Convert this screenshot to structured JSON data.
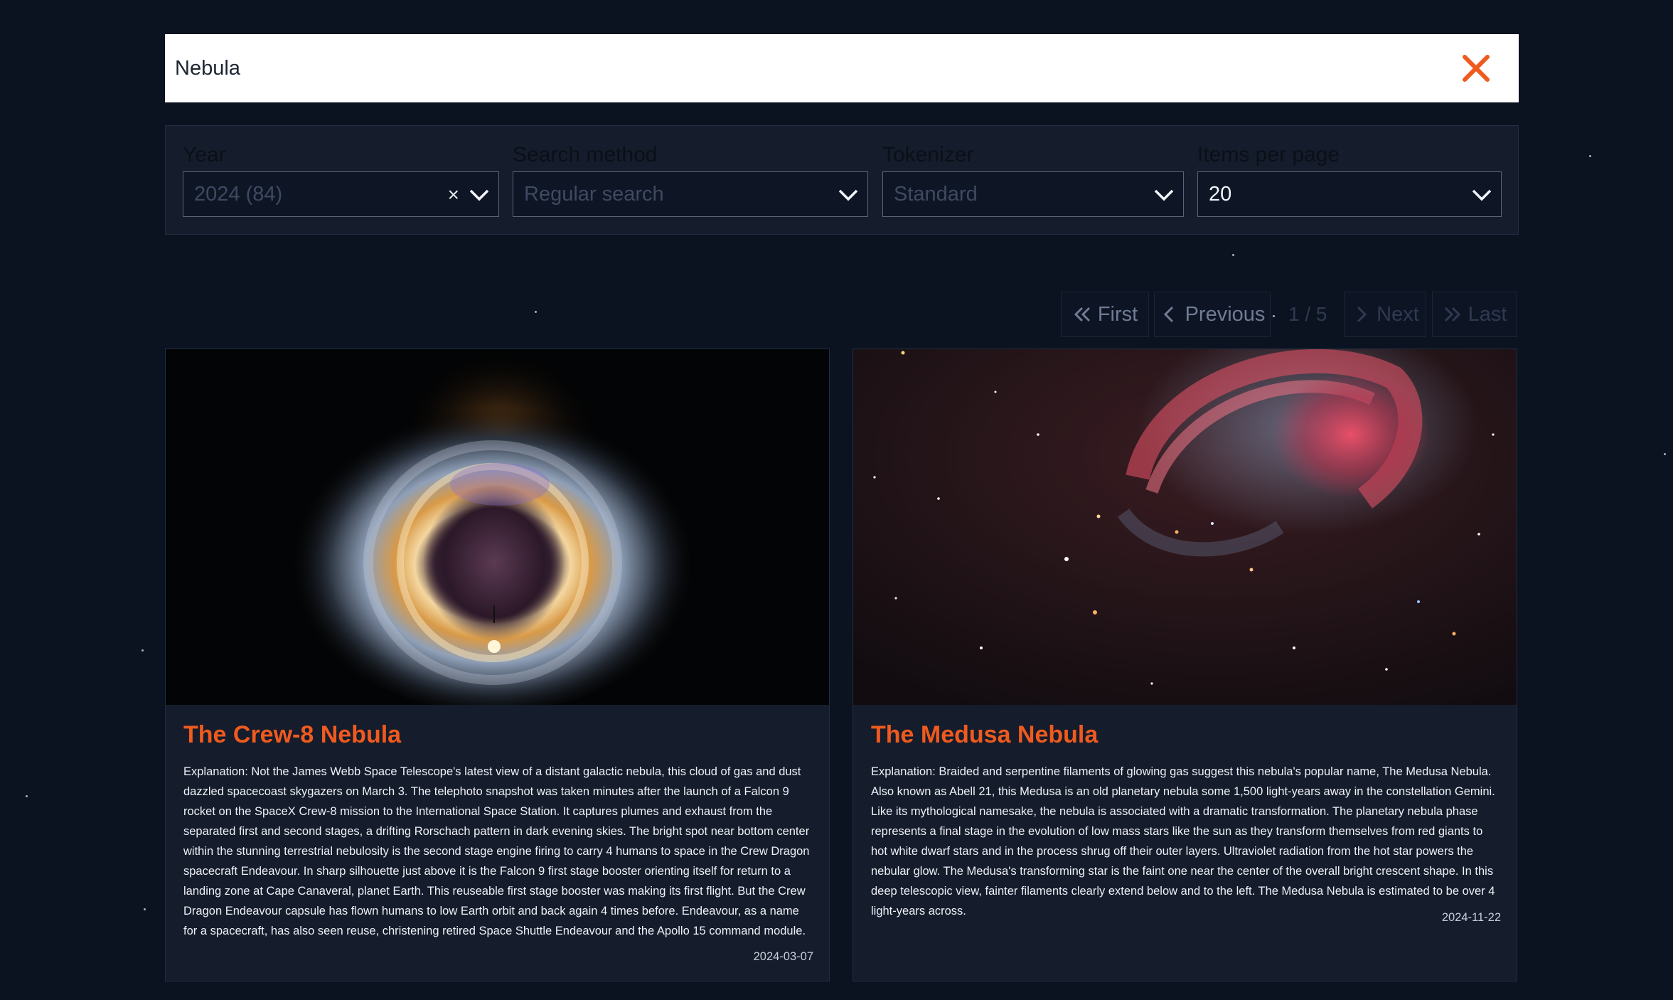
{
  "search": {
    "value": "Nebula",
    "clear_icon": "close-icon",
    "accent_color": "#ef5a1e"
  },
  "filters": {
    "year": {
      "label": "Year",
      "value": "2024 (84)",
      "clear_glyph": "×"
    },
    "search_method": {
      "label": "Search method",
      "value": "Regular search"
    },
    "tokenizer": {
      "label": "Tokenizer",
      "value": "Standard"
    },
    "items_per_page": {
      "label": "Items per page",
      "value": "20"
    }
  },
  "pagination": {
    "first": "First",
    "previous": "Previous",
    "indicator": "1 / 5",
    "next": "Next",
    "last": "Last"
  },
  "results": [
    {
      "title": "The Crew-8 Nebula",
      "explanation": "Explanation: Not the James Webb Space Telescope's latest view of a distant galactic nebula, this cloud of gas and dust dazzled spacecoast skygazers on March 3. The telephoto snapshot was taken minutes after the launch of a Falcon 9 rocket on the SpaceX Crew-8 mission to the International Space Station. It captures plumes and exhaust from the separated first and second stages, a drifting Rorschach pattern in dark evening skies. The bright spot near bottom center within the stunning terrestrial nebulosity is the second stage engine firing to carry 4 humans to space in the Crew Dragon spacecraft Endeavour. In sharp silhouette just above it is the Falcon 9 first stage booster orienting itself for return to a landing zone at Cape Canaveral, planet Earth. This reuseable first stage booster was making its first flight. But the Crew Dragon Endeavour capsule has flown humans to low Earth orbit and back again 4 times before. Endeavour, as a name for a spacecraft, has also seen reuse, christening retired Space Shuttle Endeavour and the Apollo 15 command module.",
      "date": "2024-03-07"
    },
    {
      "title": "The Medusa Nebula",
      "explanation": "Explanation: Braided and serpentine filaments of glowing gas suggest this nebula's popular name, The Medusa Nebula. Also known as Abell 21, this Medusa is an old planetary nebula some 1,500 light-years away in the constellation Gemini. Like its mythological namesake, the nebula is associated with a dramatic transformation. The planetary nebula phase represents a final stage in the evolution of low mass stars like the sun as they transform themselves from red giants to hot white dwarf stars and in the process shrug off their outer layers. Ultraviolet radiation from the hot star powers the nebular glow. The Medusa's transforming star is the faint one near the center of the overall bright crescent shape. In this deep telescopic view, fainter filaments clearly extend below and to the left. The Medusa Nebula is estimated to be over 4 light-years across.",
      "date": "2024-11-22"
    }
  ]
}
